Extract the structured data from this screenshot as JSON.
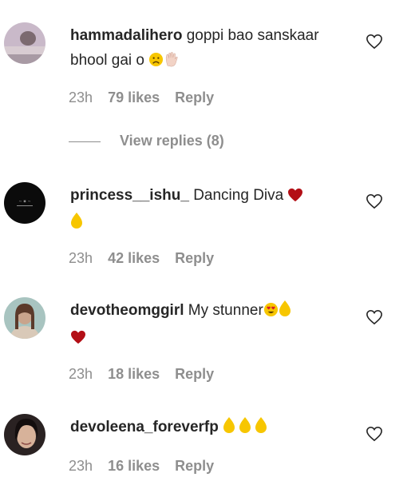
{
  "comments": [
    {
      "username": "hammadalihero",
      "text": "goppi bao sanskaar bhool gai o",
      "emojis": [
        "frowning-face",
        "raised-hand-light"
      ],
      "time": "23h",
      "likes": "79 likes",
      "reply": "Reply",
      "view_replies": "View replies (8)"
    },
    {
      "username": "princess__ishu_",
      "text": "Dancing Diva",
      "emojis": [
        "red-heart",
        "raised-hand-yellow"
      ],
      "time": "23h",
      "likes": "42 likes",
      "reply": "Reply"
    },
    {
      "username": "devotheomggirl",
      "text": "My stunner",
      "emojis": [
        "heart-eyes-face",
        "raised-hand-yellow",
        "red-heart"
      ],
      "time": "23h",
      "likes": "18 likes",
      "reply": "Reply"
    },
    {
      "username": "devoleena_foreverfp",
      "text": "",
      "emojis": [
        "raised-hand-yellow",
        "raised-hand-yellow",
        "raised-hand-yellow"
      ],
      "time": "23h",
      "likes": "16 likes",
      "reply": "Reply"
    }
  ],
  "colors": {
    "text": "#262626",
    "meta": "#8e8e8e",
    "heart_emoji": "#b30f16",
    "hand_yellow": "#f7c600"
  }
}
